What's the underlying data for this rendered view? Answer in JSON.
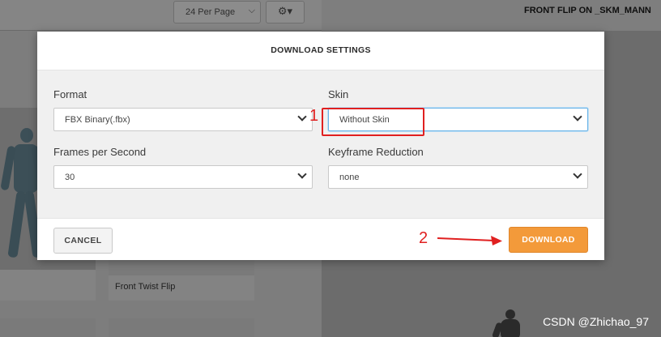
{
  "background": {
    "per_page_label": "24 Per Page",
    "animation_title": "FRONT FLIP ON _SKM_MANN",
    "card_label": "Front Twist Flip"
  },
  "modal": {
    "title": "DOWNLOAD SETTINGS",
    "fields": {
      "format": {
        "label": "Format",
        "value": "FBX Binary(.fbx)"
      },
      "skin": {
        "label": "Skin",
        "value": "Without Skin"
      },
      "fps": {
        "label": "Frames per Second",
        "value": "30"
      },
      "keyframe": {
        "label": "Keyframe Reduction",
        "value": "none"
      }
    },
    "cancel_label": "CANCEL",
    "download_label": "DOWNLOAD"
  },
  "annotations": {
    "marker_1": "1",
    "marker_2": "2",
    "color": "#e02020"
  },
  "watermark": "CSDN @Zhichao_97",
  "colors": {
    "download_button": "#f39a3a",
    "focus_border": "#6ab3e6"
  },
  "icons": [
    "chevron-down-icon",
    "gear-icon",
    "arrow-right-icon"
  ]
}
